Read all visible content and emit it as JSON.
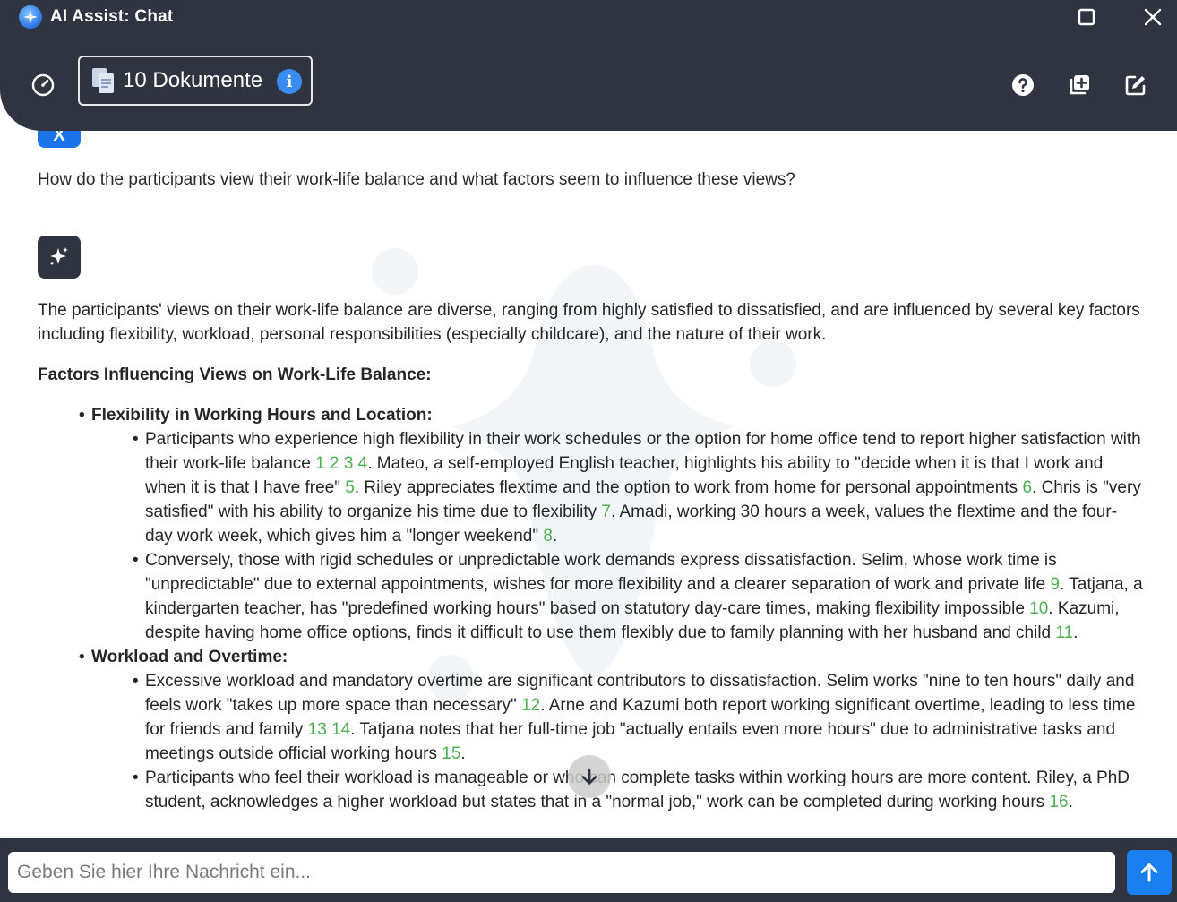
{
  "window": {
    "title": "AI Assist: Chat",
    "logo_icon": "sparkle-logo-icon"
  },
  "header": {
    "documents_label": "10 Dokumente",
    "info_badge": "i",
    "icons": [
      "dashboard-gauge-icon",
      "documents-icon",
      "help-icon",
      "new-chat-copy-icon",
      "edit-icon"
    ]
  },
  "chat": {
    "user_question": "How do the participants view their work-life balance and what factors seem to influence these views?",
    "answer": {
      "intro": "The participants' views on their work-life balance are diverse, ranging from highly satisfied to dissatisfied, and are influenced by several key factors including flexibility, workload, personal responsibilities (especially childcare), and the nature of their work.",
      "heading": "Factors Influencing Views on Work-Life Balance:",
      "sections": [
        {
          "title": "Flexibility in Working Hours and Location:",
          "points": [
            [
              {
                "t": "Participants who experience high flexibility in their work schedules or the option for home office tend to report higher satisfaction with their work-life balance "
              },
              {
                "c": "1"
              },
              {
                "t": " "
              },
              {
                "c": "2"
              },
              {
                "t": " "
              },
              {
                "c": "3"
              },
              {
                "t": " "
              },
              {
                "c": "4"
              },
              {
                "t": ". Mateo, a self-employed English teacher, highlights his ability to \"decide when it is that I work and when it is that I have free\" "
              },
              {
                "c": "5"
              },
              {
                "t": ". Riley appreciates flextime and the option to work from home for personal appointments "
              },
              {
                "c": "6"
              },
              {
                "t": ". Chris is \"very satisfied\" with his ability to organize his time due to flexibility "
              },
              {
                "c": "7"
              },
              {
                "t": ". Amadi, working 30 hours a week, values the flextime and the four-day work week, which gives him a \"longer weekend\" "
              },
              {
                "c": "8"
              },
              {
                "t": "."
              }
            ],
            [
              {
                "t": "Conversely, those with rigid schedules or unpredictable work demands express dissatisfaction. Selim, whose work time is \"unpredictable\" due to external appointments, wishes for more flexibility and a clearer separation of work and private life "
              },
              {
                "c": "9"
              },
              {
                "t": ". Tatjana, a kindergarten teacher, has \"predefined working hours\" based on statutory day-care times, making flexibility impossible "
              },
              {
                "c": "10"
              },
              {
                "t": ". Kazumi, despite having home office options, finds it difficult to use them flexibly due to family planning with her husband and child "
              },
              {
                "c": "11"
              },
              {
                "t": "."
              }
            ]
          ]
        },
        {
          "title": "Workload and Overtime:",
          "points": [
            [
              {
                "t": "Excessive workload and mandatory overtime are significant contributors to dissatisfaction. Selim works \"nine to ten hours\" daily and feels work \"takes up more space than necessary\" "
              },
              {
                "c": "12"
              },
              {
                "t": ". Arne and Kazumi both report working significant overtime, leading to less time for friends and family "
              },
              {
                "c": "13"
              },
              {
                "t": " "
              },
              {
                "c": "14"
              },
              {
                "t": ". Tatjana notes that her full-time job \"actually entails even more hours\" due to administrative tasks and meetings outside official working hours "
              },
              {
                "c": "15"
              },
              {
                "t": "."
              }
            ],
            [
              {
                "t": "Participants who feel their workload is manageable or who can complete tasks within working hours are more content. Riley, a PhD student, acknowledges a higher workload but states that in a \"normal job,\" work can be completed during working hours "
              },
              {
                "c": "16"
              },
              {
                "t": "."
              }
            ]
          ]
        }
      ]
    }
  },
  "footer": {
    "input_placeholder": "Geben Sie hier Ihre Nachricht ein...",
    "input_value": ""
  },
  "colors": {
    "bar_bg": "#2f3440",
    "citation": "#4caf50",
    "accent": "#1a7ff0"
  }
}
